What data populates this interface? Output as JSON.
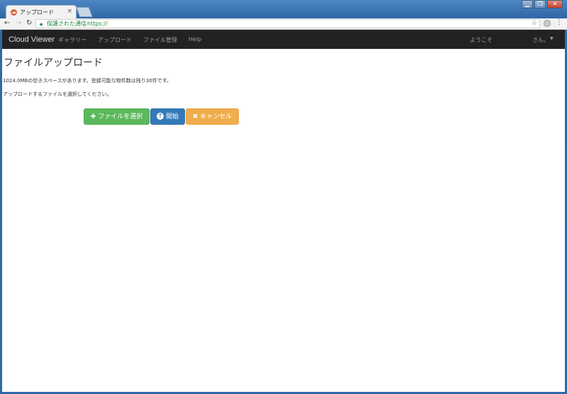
{
  "browser": {
    "tab_title": "アップロード",
    "tab_close": "×",
    "secure_label": "保護された通信",
    "url": "https://",
    "separator": "|"
  },
  "navbar": {
    "brand": "Cloud Viewer",
    "links": [
      "ギャラリー",
      "アップロード",
      "ファイル管理",
      "Help"
    ],
    "welcome": "ようこそ",
    "user": "さん。"
  },
  "page": {
    "title": "ファイルアップロード",
    "space_info": "1024.0MBの空きスペースがあります。登録可能な物件数は残り30件です。",
    "instruction": "アップロードするファイルを選択してください。"
  },
  "buttons": {
    "select_label": "ファイルを選択",
    "start_label": "開始",
    "cancel_label": "キャンセル"
  },
  "colors": {
    "navbar": "#222222",
    "success": "#5cb85c",
    "primary": "#337ab7",
    "warning": "#f0ad4e"
  }
}
